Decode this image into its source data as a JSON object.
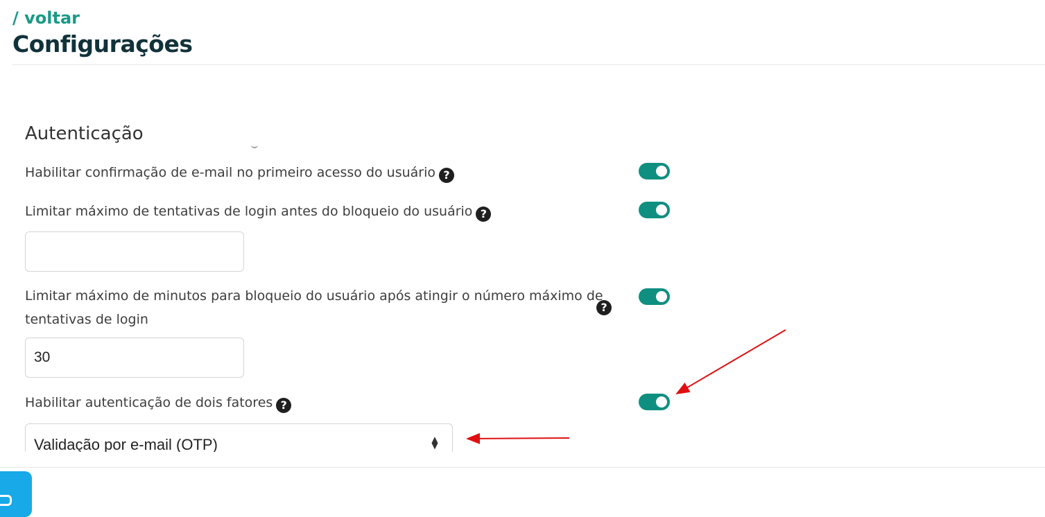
{
  "header": {
    "back_link": "/ voltar",
    "title": "Configurações"
  },
  "section": {
    "title": "Autenticação"
  },
  "options": [
    {
      "label": "Habilitar confirmação de e-mail no primeiro acesso do usuário",
      "enabled": true
    },
    {
      "label": "Limitar máximo de tentativas de login antes do bloqueio do usuário",
      "enabled": true,
      "input_value": ""
    },
    {
      "label_line1": "Limitar máximo de minutos para bloqueio do usuário após atingir o número máximo de",
      "label_line2": "tentativas de login",
      "enabled": true,
      "input_value": "30"
    },
    {
      "label": "Habilitar autenticação de dois fatores",
      "enabled": true,
      "select_value": "Validação por e-mail (OTP)"
    }
  ],
  "icons": {
    "help": "?",
    "help_icon_name": "question-circle-icon",
    "select_caret": "▲▼",
    "chat_icon_name": "chat-icon"
  },
  "colors": {
    "accent": "#1a9a86",
    "toggle_on": "#0f8f80",
    "title": "#12323a",
    "annotation_arrow": "#e01010",
    "chat_button": "#17a9e8"
  }
}
